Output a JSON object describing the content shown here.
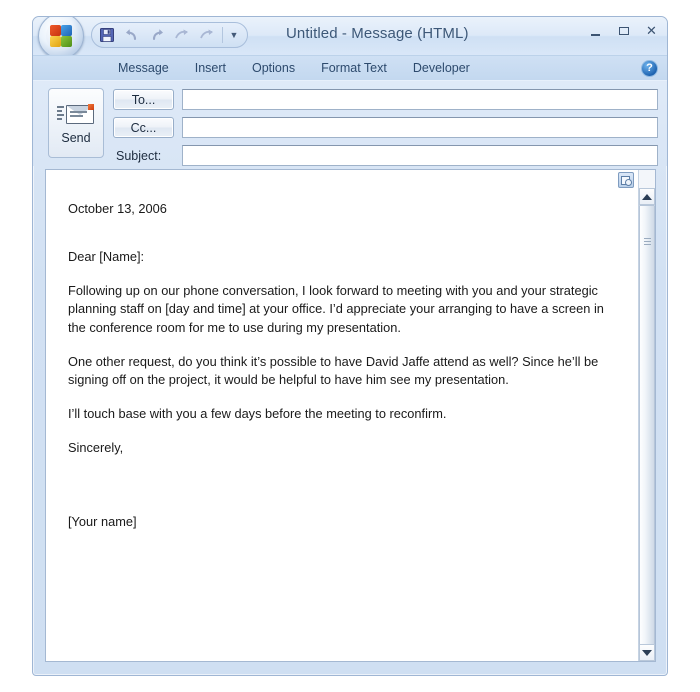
{
  "window": {
    "title": "Untitled - Message (HTML)",
    "office_orb": "office-orb-button",
    "controls": {
      "minimize": "minimize",
      "maximize": "maximize",
      "close": "✕"
    }
  },
  "quick_access": {
    "items": [
      {
        "name": "save-icon",
        "label": "Save"
      },
      {
        "name": "undo-icon",
        "label": "Undo"
      },
      {
        "name": "redo-icon",
        "label": "Redo"
      },
      {
        "name": "previous-item-icon",
        "label": "Previous Item"
      },
      {
        "name": "next-item-icon",
        "label": "Next Item"
      }
    ],
    "customize_label": "▼"
  },
  "ribbon": {
    "tabs": [
      {
        "label": "Message",
        "active": true
      },
      {
        "label": "Insert",
        "active": false
      },
      {
        "label": "Options",
        "active": false
      },
      {
        "label": "Format Text",
        "active": false
      },
      {
        "label": "Developer",
        "active": false
      }
    ],
    "help_label": "?"
  },
  "compose": {
    "send_label": "Send",
    "to_label": "To...",
    "cc_label": "Cc...",
    "subject_label": "Subject:",
    "to_value": "",
    "cc_value": "",
    "subject_value": "",
    "to_placeholder": "",
    "cc_placeholder": "",
    "subject_placeholder": ""
  },
  "body": {
    "date": "October 13, 2006",
    "salutation": "Dear [Name]:",
    "paragraph_1": "Following up on our phone conversation, I look forward to meeting with you and your strategic planning staff on [day and time] at your office. I’d appreciate your arranging to have a screen in the conference room for me to use during my presentation.",
    "paragraph_2": "One other request, do you think it’s possible to have David Jaffe attend as well? Since he’ll be signing off on the project, it would be helpful to have him see my presentation.",
    "paragraph_3": "I’ll touch base with you a few days before the meeting to reconfirm.",
    "closing": "Sincerely,",
    "signature": "[Your name]"
  },
  "scrollbar": {
    "up_label": "▲",
    "down_label": "▼"
  },
  "colors": {
    "window_frame": "#9fb6d4",
    "titlebar": "#dde9f8",
    "ribbon_tabs": "#c3d8ef",
    "accent_blue": "#1a5fad",
    "body_bg": "#ffffff",
    "text": "#1a1a1a"
  }
}
